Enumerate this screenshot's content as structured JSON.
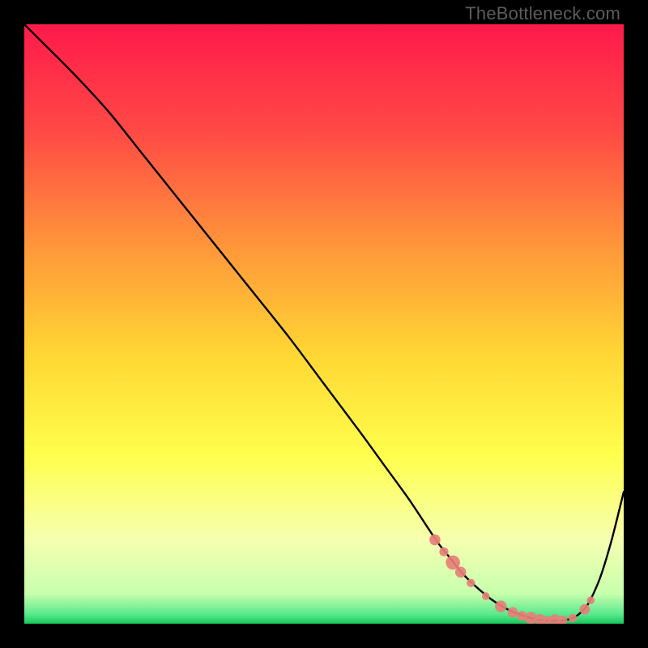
{
  "watermark": "TheBottleneck.com",
  "colors": {
    "gradient_top": "#ff1a4b",
    "gradient_mid_upper": "#ff7a3a",
    "gradient_mid": "#ffd633",
    "gradient_mid_lower": "#ffff4d",
    "gradient_lower": "#f5ffb0",
    "gradient_bottom": "#23e06b",
    "curve": "#000000",
    "markers": "#e77f78",
    "background": "#000000"
  },
  "chart_data": {
    "type": "line",
    "title": "",
    "xlabel": "",
    "ylabel": "",
    "xlim": [
      0,
      100
    ],
    "ylim": [
      0,
      100
    ],
    "curve": {
      "x": [
        0,
        3,
        8,
        14,
        20,
        28,
        36,
        44,
        50,
        56,
        60,
        64,
        67,
        69,
        71,
        73,
        75,
        78,
        81,
        84,
        86,
        88,
        90,
        92,
        94,
        96,
        98,
        100
      ],
      "y": [
        100,
        97,
        92,
        85.5,
        78,
        68,
        58,
        48,
        40,
        32,
        26.5,
        21,
        16.5,
        13.5,
        11,
        8.5,
        6.5,
        4,
        2.2,
        1.1,
        0.6,
        0.5,
        0.55,
        1.2,
        3.2,
        7.5,
        14,
        22
      ]
    },
    "markers": [
      {
        "x": 68.5,
        "y": 14.0,
        "r": 1.7
      },
      {
        "x": 70.0,
        "y": 12.0,
        "r": 1.4
      },
      {
        "x": 71.5,
        "y": 10.2,
        "r": 2.2
      },
      {
        "x": 72.8,
        "y": 8.6,
        "r": 1.7
      },
      {
        "x": 74.5,
        "y": 6.8,
        "r": 1.3
      },
      {
        "x": 77.0,
        "y": 4.6,
        "r": 1.2
      },
      {
        "x": 79.5,
        "y": 2.9,
        "r": 1.8
      },
      {
        "x": 81.5,
        "y": 1.9,
        "r": 1.6
      },
      {
        "x": 83.0,
        "y": 1.3,
        "r": 1.5
      },
      {
        "x": 84.5,
        "y": 0.95,
        "r": 1.9
      },
      {
        "x": 86.0,
        "y": 0.7,
        "r": 1.7
      },
      {
        "x": 87.2,
        "y": 0.6,
        "r": 1.3
      },
      {
        "x": 88.5,
        "y": 0.55,
        "r": 1.9
      },
      {
        "x": 89.8,
        "y": 0.55,
        "r": 1.5
      },
      {
        "x": 91.5,
        "y": 0.95,
        "r": 1.3
      },
      {
        "x": 93.5,
        "y": 2.4,
        "r": 1.6
      },
      {
        "x": 94.5,
        "y": 3.9,
        "r": 1.2
      }
    ]
  }
}
